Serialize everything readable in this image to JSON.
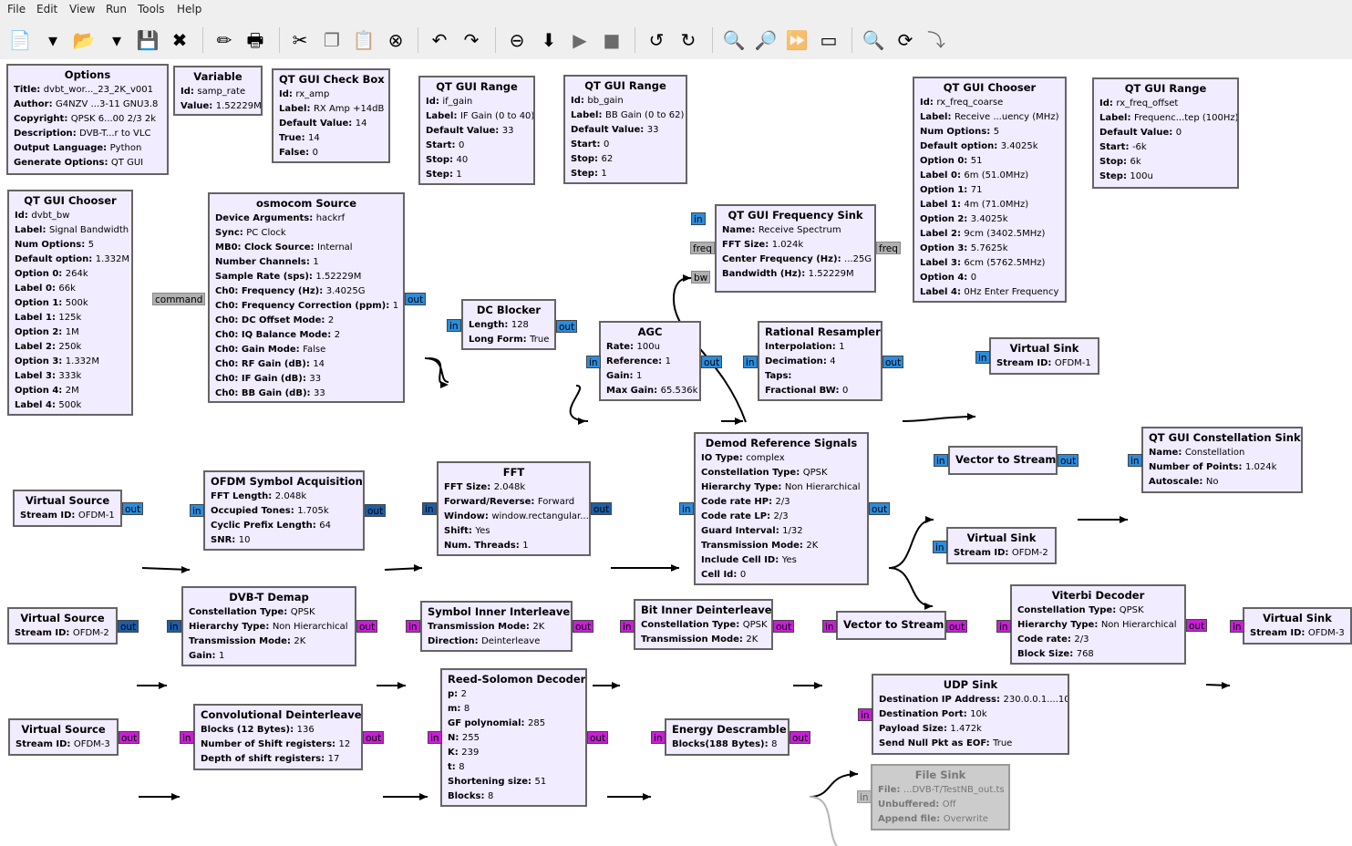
{
  "menu": [
    "File",
    "Edit",
    "View",
    "Run",
    "Tools",
    "Help"
  ],
  "toolbar": [
    {
      "icon": "new-icon",
      "glyph": "📄"
    },
    {
      "icon": "dropdown-arrow-icon",
      "glyph": "▾"
    },
    {
      "icon": "open-icon",
      "glyph": "📂"
    },
    {
      "icon": "dropdown-arrow-icon",
      "glyph": "▾"
    },
    {
      "icon": "save-icon",
      "glyph": "💾"
    },
    {
      "icon": "close-icon",
      "glyph": "✖"
    },
    {
      "icon": "edit-pencil-icon",
      "glyph": "✏"
    },
    {
      "icon": "print-icon",
      "glyph": "🖶"
    },
    {
      "icon": "cut-icon",
      "glyph": "✂"
    },
    {
      "icon": "copy-icon",
      "glyph": "❐"
    },
    {
      "icon": "paste-icon",
      "glyph": "📋"
    },
    {
      "icon": "delete-icon",
      "glyph": "⊗"
    },
    {
      "icon": "undo-icon",
      "glyph": "↶"
    },
    {
      "icon": "redo-icon",
      "glyph": "↷"
    },
    {
      "icon": "disable-block-icon",
      "glyph": "⊖"
    },
    {
      "icon": "generate-icon",
      "glyph": "⬇"
    },
    {
      "icon": "execute-icon",
      "glyph": "▶"
    },
    {
      "icon": "stop-icon",
      "glyph": "■"
    },
    {
      "icon": "rotate-ccw-icon",
      "glyph": "↺"
    },
    {
      "icon": "rotate-cw-icon",
      "glyph": "↻"
    },
    {
      "icon": "find-block-icon",
      "glyph": "🔍"
    },
    {
      "icon": "zoom-icon",
      "glyph": "🔎"
    },
    {
      "icon": "bypass-icon",
      "glyph": "⏩"
    },
    {
      "icon": "screenshot-icon",
      "glyph": "▭"
    },
    {
      "icon": "search-icon",
      "glyph": "🔍"
    },
    {
      "icon": "reload-icon",
      "glyph": "⟳"
    },
    {
      "icon": "hier-block-icon",
      "glyph": "⤵"
    }
  ],
  "blocks": [
    {
      "id": "options",
      "title": "Options",
      "params": [
        [
          "Title",
          "dvbt_wor..._23_2K_v001"
        ],
        [
          "Author",
          "G4NZV  ...3-11 GNU3.8"
        ],
        [
          "Copyright",
          "QPSK 6...00 2/3 2k"
        ],
        [
          "Description",
          "DVB-T...r to VLC"
        ],
        [
          "Output Language",
          "Python"
        ],
        [
          "Generate Options",
          "QT GUI"
        ]
      ]
    },
    {
      "id": "variable",
      "title": "Variable",
      "params": [
        [
          "Id",
          "samp_rate"
        ],
        [
          "Value",
          "1.52229M"
        ]
      ]
    },
    {
      "id": "check-box",
      "title": "QT GUI Check Box",
      "params": [
        [
          "Id",
          "rx_amp"
        ],
        [
          "Label",
          "RX Amp +14dB"
        ],
        [
          "Default Value",
          "14"
        ],
        [
          "True",
          "14"
        ],
        [
          "False",
          "0"
        ]
      ]
    },
    {
      "id": "range-if-gain",
      "title": "QT GUI Range",
      "params": [
        [
          "Id",
          "if_gain"
        ],
        [
          "Label",
          "IF Gain (0 to 40)"
        ],
        [
          "Default Value",
          "33"
        ],
        [
          "Start",
          "0"
        ],
        [
          "Stop",
          "40"
        ],
        [
          "Step",
          "1"
        ]
      ]
    },
    {
      "id": "range-bb-gain",
      "title": "QT GUI Range",
      "params": [
        [
          "Id",
          "bb_gain"
        ],
        [
          "Label",
          "BB Gain (0 to 62)"
        ],
        [
          "Default Value",
          "33"
        ],
        [
          "Start",
          "0"
        ],
        [
          "Stop",
          "62"
        ],
        [
          "Step",
          "1"
        ]
      ]
    },
    {
      "id": "chooser-rx-freq",
      "title": "QT GUI Chooser",
      "params": [
        [
          "Id",
          "rx_freq_coarse"
        ],
        [
          "Label",
          "Receive ...uency (MHz)"
        ],
        [
          "Num Options",
          "5"
        ],
        [
          "Default option",
          "3.4025k"
        ],
        [
          "Option 0",
          "51"
        ],
        [
          "Label 0",
          "6m (51.0MHz)"
        ],
        [
          "Option 1",
          "71"
        ],
        [
          "Label 1",
          "4m (71.0MHz)"
        ],
        [
          "Option 2",
          "3.4025k"
        ],
        [
          "Label 2",
          "9cm (3402.5MHz)"
        ],
        [
          "Option 3",
          "5.7625k"
        ],
        [
          "Label 3",
          "6cm (5762.5MHz)"
        ],
        [
          "Option 4",
          "0"
        ],
        [
          "Label 4",
          "0Hz Enter Frequency"
        ]
      ]
    },
    {
      "id": "range-freq-offset",
      "title": "QT GUI Range",
      "params": [
        [
          "Id",
          "rx_freq_offset"
        ],
        [
          "Label",
          "Frequenc...tep (100Hz)"
        ],
        [
          "Default Value",
          "0"
        ],
        [
          "Start",
          "-6k"
        ],
        [
          "Stop",
          "6k"
        ],
        [
          "Step",
          "100u"
        ]
      ]
    },
    {
      "id": "chooser-bw",
      "title": "QT GUI Chooser",
      "params": [
        [
          "Id",
          "dvbt_bw"
        ],
        [
          "Label",
          "Signal Bandwidth"
        ],
        [
          "Num Options",
          "5"
        ],
        [
          "Default option",
          "1.332M"
        ],
        [
          "Option 0",
          "264k"
        ],
        [
          "Label 0",
          "66k"
        ],
        [
          "Option 1",
          "500k"
        ],
        [
          "Label 1",
          "125k"
        ],
        [
          "Option 2",
          "1M"
        ],
        [
          "Label 2",
          "250k"
        ],
        [
          "Option 3",
          "1.332M"
        ],
        [
          "Label 3",
          "333k"
        ],
        [
          "Option 4",
          "2M"
        ],
        [
          "Label 4",
          "500k"
        ]
      ]
    },
    {
      "id": "osmocom-source",
      "title": "osmocom Source",
      "params": [
        [
          "Device Arguments",
          "hackrf"
        ],
        [
          "Sync",
          "PC Clock"
        ],
        [
          "MB0: Clock Source",
          "Internal"
        ],
        [
          "Number Channels",
          "1"
        ],
        [
          "Sample Rate (sps)",
          "1.52229M"
        ],
        [
          "Ch0: Frequency (Hz)",
          "3.4025G"
        ],
        [
          "Ch0: Frequency Correction (ppm)",
          "1"
        ],
        [
          "Ch0: DC Offset Mode",
          "2"
        ],
        [
          "Ch0: IQ Balance Mode",
          "2"
        ],
        [
          "Ch0: Gain Mode",
          "False"
        ],
        [
          "Ch0: RF Gain (dB)",
          "14"
        ],
        [
          "Ch0: IF Gain (dB)",
          "33"
        ],
        [
          "Ch0: BB Gain (dB)",
          "33"
        ]
      ]
    },
    {
      "id": "freq-sink",
      "title": "QT GUI Frequency Sink",
      "params": [
        [
          "Name",
          "Receive Spectrum"
        ],
        [
          "FFT Size",
          "1.024k"
        ],
        [
          "Center Frequency (Hz)",
          "...25G"
        ],
        [
          "Bandwidth (Hz)",
          "1.52229M"
        ]
      ]
    },
    {
      "id": "dc-blocker",
      "title": "DC Blocker",
      "params": [
        [
          "Length",
          "128"
        ],
        [
          "Long Form",
          "True"
        ]
      ]
    },
    {
      "id": "agc",
      "title": "AGC",
      "params": [
        [
          "Rate",
          "100u"
        ],
        [
          "Reference",
          "1"
        ],
        [
          "Gain",
          "1"
        ],
        [
          "Max Gain",
          "65.536k"
        ]
      ]
    },
    {
      "id": "rational-resampler",
      "title": "Rational Resampler",
      "params": [
        [
          "Interpolation",
          "1"
        ],
        [
          "Decimation",
          "4"
        ],
        [
          "Taps",
          ""
        ],
        [
          "Fractional BW",
          "0"
        ]
      ]
    },
    {
      "id": "virtual-sink-1",
      "title": "Virtual Sink",
      "params": [
        [
          "Stream ID",
          "OFDM-1"
        ]
      ]
    },
    {
      "id": "virtual-source-1",
      "title": "Virtual Source",
      "params": [
        [
          "Stream ID",
          "OFDM-1"
        ]
      ]
    },
    {
      "id": "ofdm-acq",
      "title": "OFDM Symbol Acquisition",
      "params": [
        [
          "FFT Length",
          "2.048k"
        ],
        [
          "Occupied Tones",
          "1.705k"
        ],
        [
          "Cyclic Prefix Length",
          "64"
        ],
        [
          "SNR",
          "10"
        ]
      ]
    },
    {
      "id": "fft",
      "title": "FFT",
      "params": [
        [
          "FFT Size",
          "2.048k"
        ],
        [
          "Forward/Reverse",
          "Forward"
        ],
        [
          "Window",
          "window.rectangular..."
        ],
        [
          "Shift",
          "Yes"
        ],
        [
          "Num. Threads",
          "1"
        ]
      ]
    },
    {
      "id": "demod-ref",
      "title": "Demod Reference Signals",
      "params": [
        [
          "IO Type",
          "complex"
        ],
        [
          "Constellation Type",
          "QPSK"
        ],
        [
          "Hierarchy Type",
          "Non Hierarchical"
        ],
        [
          "Code rate HP",
          "2/3"
        ],
        [
          "Code rate LP",
          "2/3"
        ],
        [
          "Guard Interval",
          "1/32"
        ],
        [
          "Transmission Mode",
          "2K"
        ],
        [
          "Include Cell ID",
          "Yes"
        ],
        [
          "Cell Id",
          "0"
        ]
      ]
    },
    {
      "id": "vec2stream-1",
      "title": "Vector to Stream",
      "params": []
    },
    {
      "id": "const-sink",
      "title": "QT GUI Constellation Sink",
      "params": [
        [
          "Name",
          "Constellation"
        ],
        [
          "Number of Points",
          "1.024k"
        ],
        [
          "Autoscale",
          "No"
        ]
      ]
    },
    {
      "id": "virtual-sink-2",
      "title": "Virtual Sink",
      "params": [
        [
          "Stream ID",
          "OFDM-2"
        ]
      ]
    },
    {
      "id": "virtual-source-2",
      "title": "Virtual Source",
      "params": [
        [
          "Stream ID",
          "OFDM-2"
        ]
      ]
    },
    {
      "id": "dvbt-demap",
      "title": "DVB-T Demap",
      "params": [
        [
          "Constellation Type",
          "QPSK"
        ],
        [
          "Hierarchy Type",
          "Non Hierarchical"
        ],
        [
          "Transmission Mode",
          "2K"
        ],
        [
          "Gain",
          "1"
        ]
      ]
    },
    {
      "id": "sym-deinterleaver",
      "title": "Symbol Inner Interleaver",
      "params": [
        [
          "Transmission Mode",
          "2K"
        ],
        [
          "Direction",
          "Deinterleave"
        ]
      ]
    },
    {
      "id": "bit-deinterleaver",
      "title": "Bit Inner Deinterleaver",
      "params": [
        [
          "Constellation Type",
          "QPSK"
        ],
        [
          "Transmission Mode",
          "2K"
        ]
      ]
    },
    {
      "id": "vec2stream-2",
      "title": "Vector to Stream",
      "params": []
    },
    {
      "id": "viterbi",
      "title": "Viterbi Decoder",
      "params": [
        [
          "Constellation Type",
          "QPSK"
        ],
        [
          "Hierarchy Type",
          "Non Hierarchical"
        ],
        [
          "Code rate",
          "2/3"
        ],
        [
          "Block Size",
          "768"
        ]
      ]
    },
    {
      "id": "virtual-sink-3",
      "title": "Virtual Sink",
      "params": [
        [
          "Stream ID",
          "OFDM-3"
        ]
      ]
    },
    {
      "id": "virtual-source-3",
      "title": "Virtual Source",
      "params": [
        [
          "Stream ID",
          "OFDM-3"
        ]
      ]
    },
    {
      "id": "conv-deinterleaver",
      "title": "Convolutional Deinterleaver",
      "params": [
        [
          "Blocks (12 Bytes)",
          "136"
        ],
        [
          "Number of Shift registers",
          "12"
        ],
        [
          "Depth of shift registers",
          "17"
        ]
      ]
    },
    {
      "id": "rs-decoder",
      "title": "Reed-Solomon Decoder",
      "params": [
        [
          "p",
          "2"
        ],
        [
          "m",
          "8"
        ],
        [
          "GF polynomial",
          "285"
        ],
        [
          "N",
          "255"
        ],
        [
          "K",
          "239"
        ],
        [
          "t",
          "8"
        ],
        [
          "Shortening size",
          "51"
        ],
        [
          "Blocks",
          "8"
        ]
      ]
    },
    {
      "id": "energy-descramble",
      "title": "Energy Descramble",
      "params": [
        [
          "Blocks(188 Bytes)",
          "8"
        ]
      ]
    },
    {
      "id": "udp-sink",
      "title": "UDP Sink",
      "params": [
        [
          "Destination IP Address",
          "230.0.0.1....10"
        ],
        [
          "Destination Port",
          "10k"
        ],
        [
          "Payload Size",
          "1.472k"
        ],
        [
          "Send Null Pkt as EOF",
          "True"
        ]
      ]
    },
    {
      "id": "file-sink",
      "title": "File Sink",
      "params": [
        [
          "File",
          "...DVB-T/TestNB_out.ts"
        ],
        [
          "Unbuffered",
          "Off"
        ],
        [
          "Append file",
          "Overwrite"
        ]
      ]
    }
  ],
  "ports": [
    {
      "id": "osmo-command",
      "label": "command"
    },
    {
      "id": "osmo-out",
      "label": "out"
    },
    {
      "id": "dc-in",
      "label": "in"
    },
    {
      "id": "dc-out",
      "label": "out"
    },
    {
      "id": "agc-in",
      "label": "in"
    },
    {
      "id": "agc-out",
      "label": "out"
    },
    {
      "id": "rr-in",
      "label": "in"
    },
    {
      "id": "rr-out",
      "label": "out"
    },
    {
      "id": "vs1-in",
      "label": "in"
    },
    {
      "id": "fs-in",
      "label": "in"
    },
    {
      "id": "fs-freq-in",
      "label": "freq"
    },
    {
      "id": "fs-bw-in",
      "label": "bw"
    },
    {
      "id": "fs-freq-out",
      "label": "freq"
    },
    {
      "id": "vsrc1-out",
      "label": "out"
    },
    {
      "id": "ofdm-in",
      "label": "in"
    },
    {
      "id": "ofdm-out",
      "label": "out"
    },
    {
      "id": "fft-in",
      "label": "in"
    },
    {
      "id": "fft-out",
      "label": "out"
    },
    {
      "id": "demod-in",
      "label": "in"
    },
    {
      "id": "demod-out",
      "label": "out"
    },
    {
      "id": "v2s1-in",
      "label": "in"
    },
    {
      "id": "v2s1-out",
      "label": "out"
    },
    {
      "id": "const-in",
      "label": "in"
    },
    {
      "id": "vs2-in",
      "label": "in"
    },
    {
      "id": "vsrc2-out",
      "label": "out"
    },
    {
      "id": "demap-in",
      "label": "in"
    },
    {
      "id": "demap-out",
      "label": "out"
    },
    {
      "id": "sym-in",
      "label": "in"
    },
    {
      "id": "sym-out",
      "label": "out"
    },
    {
      "id": "bit-in",
      "label": "in"
    },
    {
      "id": "bit-out",
      "label": "out"
    },
    {
      "id": "v2s2-in",
      "label": "in"
    },
    {
      "id": "v2s2-out",
      "label": "out"
    },
    {
      "id": "vit-in",
      "label": "in"
    },
    {
      "id": "vit-out",
      "label": "out"
    },
    {
      "id": "vs3-in",
      "label": "in"
    },
    {
      "id": "vsrc3-out",
      "label": "out"
    },
    {
      "id": "conv-in",
      "label": "in"
    },
    {
      "id": "conv-out",
      "label": "out"
    },
    {
      "id": "rs-in",
      "label": "in"
    },
    {
      "id": "rs-out",
      "label": "out"
    },
    {
      "id": "ed-in",
      "label": "in"
    },
    {
      "id": "ed-out",
      "label": "out"
    },
    {
      "id": "udp-in",
      "label": "in"
    },
    {
      "id": "file-in",
      "label": "in"
    }
  ],
  "colors": {
    "complex": "#2a8cde",
    "float": "#1a5fa8",
    "byte": "#c81fd6",
    "message": "#b0b0b0",
    "block_bg": "#f1ecff",
    "disabled": "#cccccc"
  }
}
